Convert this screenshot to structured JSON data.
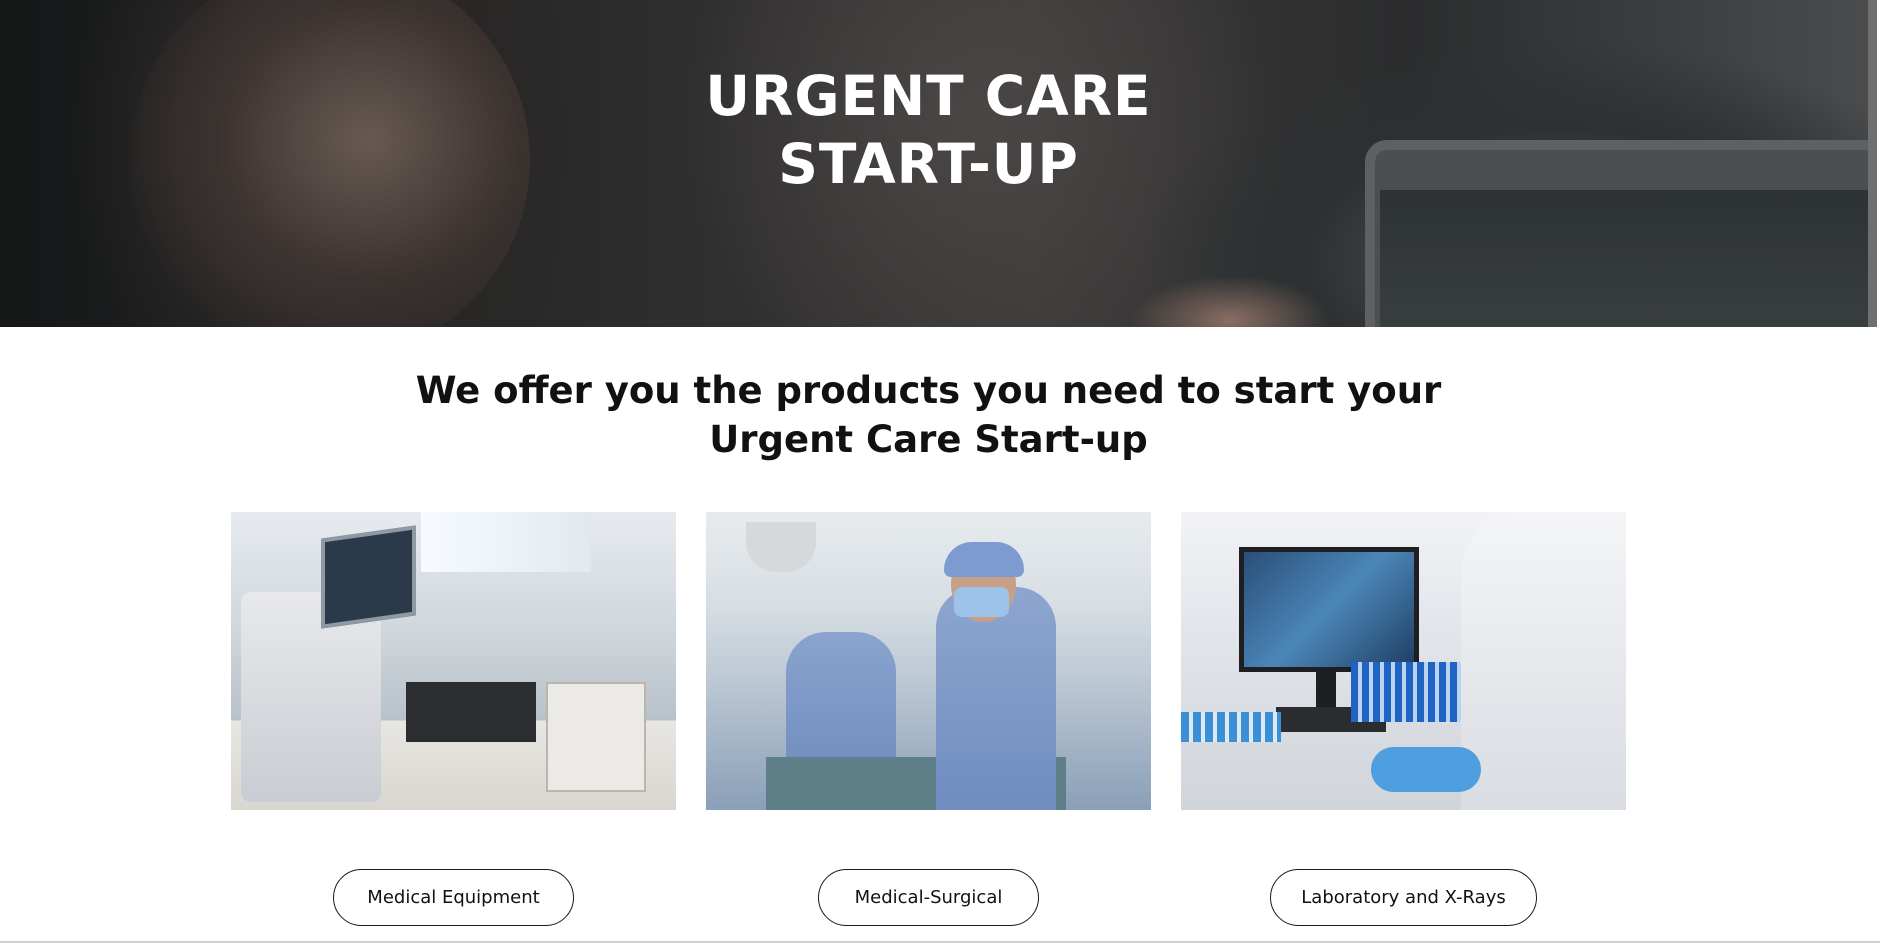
{
  "hero": {
    "title_line1": "URGENT CARE",
    "title_line2": "START-UP"
  },
  "intro": {
    "headline_line1": "We offer you the products you need to start your",
    "headline_line2": "Urgent Care Start-up"
  },
  "categories": [
    {
      "label": "Medical Equipment"
    },
    {
      "label": "Medical-Surgical"
    },
    {
      "label": "Laboratory and X-Rays"
    }
  ]
}
